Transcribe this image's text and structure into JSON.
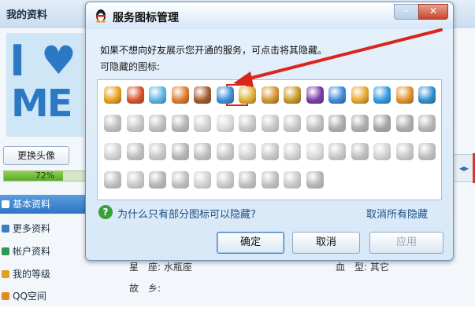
{
  "background": {
    "title": "我的资料",
    "avatar_text_i": "I",
    "avatar_text_me": "ME",
    "change_avatar": "更换头像",
    "progress_text": "72%",
    "progress": 0.72,
    "sidebar": [
      {
        "label": "基本资料",
        "icon": "profile-icon",
        "color": "#ffffff"
      },
      {
        "label": "更多资料",
        "icon": "more-info-icon",
        "color": "#3d7bc7"
      },
      {
        "label": "帐户资料",
        "icon": "account-icon",
        "color": "#2e9a52"
      },
      {
        "label": "我的等级",
        "icon": "level-icon",
        "color": "#e0a020"
      },
      {
        "label": "QQ空间",
        "icon": "qzone-icon",
        "color": "#e48a1c"
      }
    ],
    "constellation": "星　座: 水瓶座",
    "blood_type": "血　型: 其它",
    "hometown": "故　乡:",
    "right_tab": "◂▸"
  },
  "dialog": {
    "title": "服务图标管理",
    "minimize": "–",
    "close": "✕",
    "line1": "如果不想向好友展示您开通的服务，可点击将其隐藏。",
    "line2": "可隐藏的图标:",
    "help_link": "为什么只有部分图标可以隐藏?",
    "help_icon": "?",
    "cancel_all": "取消所有隐藏",
    "ok": "确定",
    "cancel": "取消",
    "apply": "应用"
  },
  "icons": [
    [
      "#e8a019",
      "#d8522a",
      "#5ab5e8",
      "#e07b2a",
      "#a35a2c",
      "#3a8ed6",
      "#e0b030",
      "#d5932e",
      "#c89a28",
      "#7a3ca8",
      "#3f88d8",
      "#e8a72a",
      "#2f9be0",
      "#e0922a",
      "#2f8fd0"
    ],
    [
      "#888888",
      "#999999",
      "#888888",
      "#777777",
      "#aaaaaa",
      "#bbbbbb",
      "#999999",
      "#999999",
      "#999999",
      "#888888",
      "#666666",
      "#666666",
      "#555555",
      "#666666",
      "#777777"
    ],
    [
      "#aaaaaa",
      "#888888",
      "#999999",
      "#777777",
      "#888888",
      "#999999",
      "#aaaaaa",
      "#999999",
      "#aaaaaa",
      "#bbbbbb",
      "#999999",
      "#888888",
      "#aaaaaa",
      "#999999",
      "#888888"
    ],
    [
      "#888888",
      "#999999",
      "#777777",
      "#888888",
      "#aaaaaa",
      "#999999",
      "#888888",
      "#888888",
      "#999999",
      "#777777"
    ]
  ]
}
